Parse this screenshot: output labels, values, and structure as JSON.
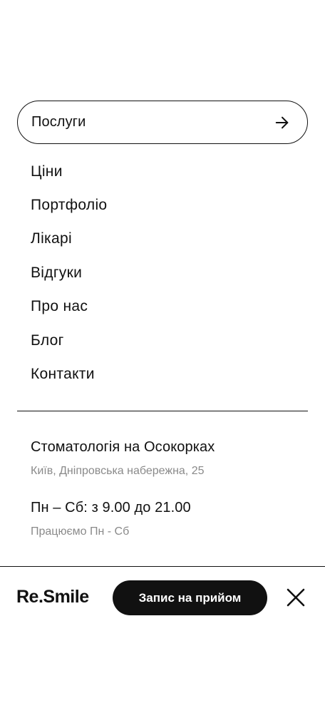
{
  "menu": {
    "featured": {
      "label": "Послуги",
      "icon": "arrow-right-icon"
    },
    "items": [
      {
        "label": "Ціни"
      },
      {
        "label": "Портфоліо"
      },
      {
        "label": "Лікарі"
      },
      {
        "label": "Відгуки"
      },
      {
        "label": "Про нас"
      },
      {
        "label": "Блог"
      },
      {
        "label": "Контакти"
      }
    ]
  },
  "clinic": {
    "name": "Стоматологія на Осокорках",
    "address": "Київ, Дніпровська набережна, 25",
    "hours": "Пн – Сб: з 9.00 до 21.00",
    "days": "Працюємо Пн - Сб"
  },
  "footer": {
    "logo": "Re.Smile",
    "cta_label": "Запис на прийом",
    "close_icon": "close-icon"
  },
  "colors": {
    "text": "#111111",
    "muted": "#8a8a8a",
    "background": "#ffffff",
    "button": "#111111",
    "button_text": "#ffffff"
  }
}
